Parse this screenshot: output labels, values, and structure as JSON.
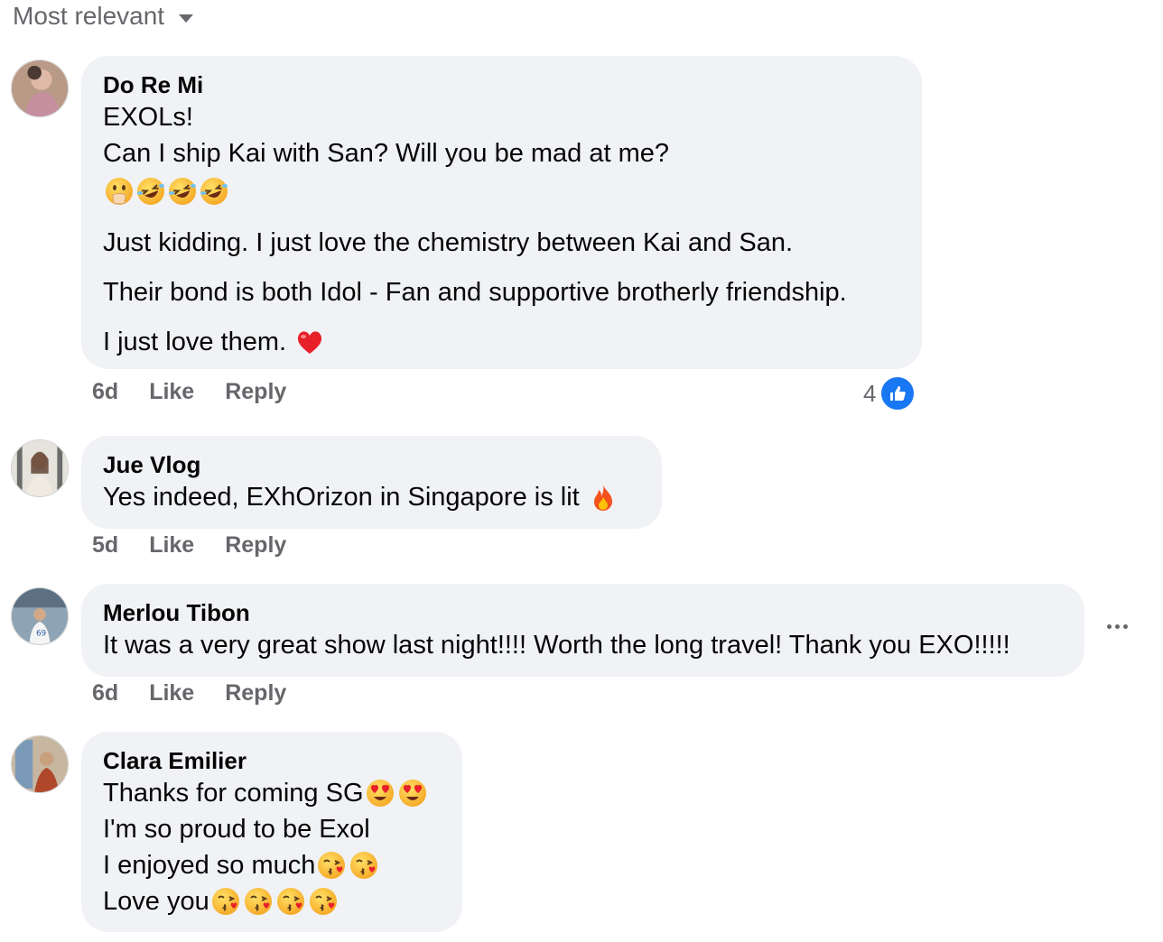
{
  "sort_label": "Most relevant",
  "colors": {
    "bubble": "#f0f2f5",
    "meta": "#65676b",
    "like_blue": "#1877f2"
  },
  "comments": [
    {
      "author": "Do Re Mi",
      "lines": [
        "EXOLs!",
        "Can I ship Kai with San? Will you be mad at me?",
        "",
        "Just kidding. I just love the chemistry between Kai and San.",
        "Their bond is both Idol - Fan and supportive brotherly friendship.",
        "I just love them."
      ],
      "emoji_row": [
        "face-with-hand-over-mouth",
        "rolling-on-floor-laughing",
        "rolling-on-floor-laughing",
        "rolling-on-floor-laughing"
      ],
      "trailing_emoji": "red-heart",
      "time": "6d",
      "like": "Like",
      "reply": "Reply",
      "reaction_count": "4",
      "reaction_icon": "like-thumb-icon"
    },
    {
      "author": "Jue Vlog",
      "lines": [
        "Yes indeed, EXhOrizon in Singapore is lit"
      ],
      "trailing_emoji": "fire",
      "time": "5d",
      "like": "Like",
      "reply": "Reply"
    },
    {
      "author": "Merlou Tibon",
      "lines": [
        "It was a very great show last night!!!! Worth the long travel! Thank you EXO!!!!!"
      ],
      "time": "6d",
      "like": "Like",
      "reply": "Reply",
      "more_icon": "more-options-icon"
    },
    {
      "author": "Clara Emilier",
      "lines": [
        "Thanks for coming SG",
        "I'm so proud to be Exol",
        "I enjoyed so much",
        "Love you"
      ],
      "line_emojis": [
        [
          "smiling-face-with-heart-eyes",
          "smiling-face-with-heart-eyes"
        ],
        [],
        [
          "face-blowing-a-kiss",
          "face-blowing-a-kiss"
        ],
        [
          "face-blowing-a-kiss",
          "face-blowing-a-kiss",
          "face-blowing-a-kiss",
          "face-blowing-a-kiss"
        ]
      ]
    }
  ]
}
